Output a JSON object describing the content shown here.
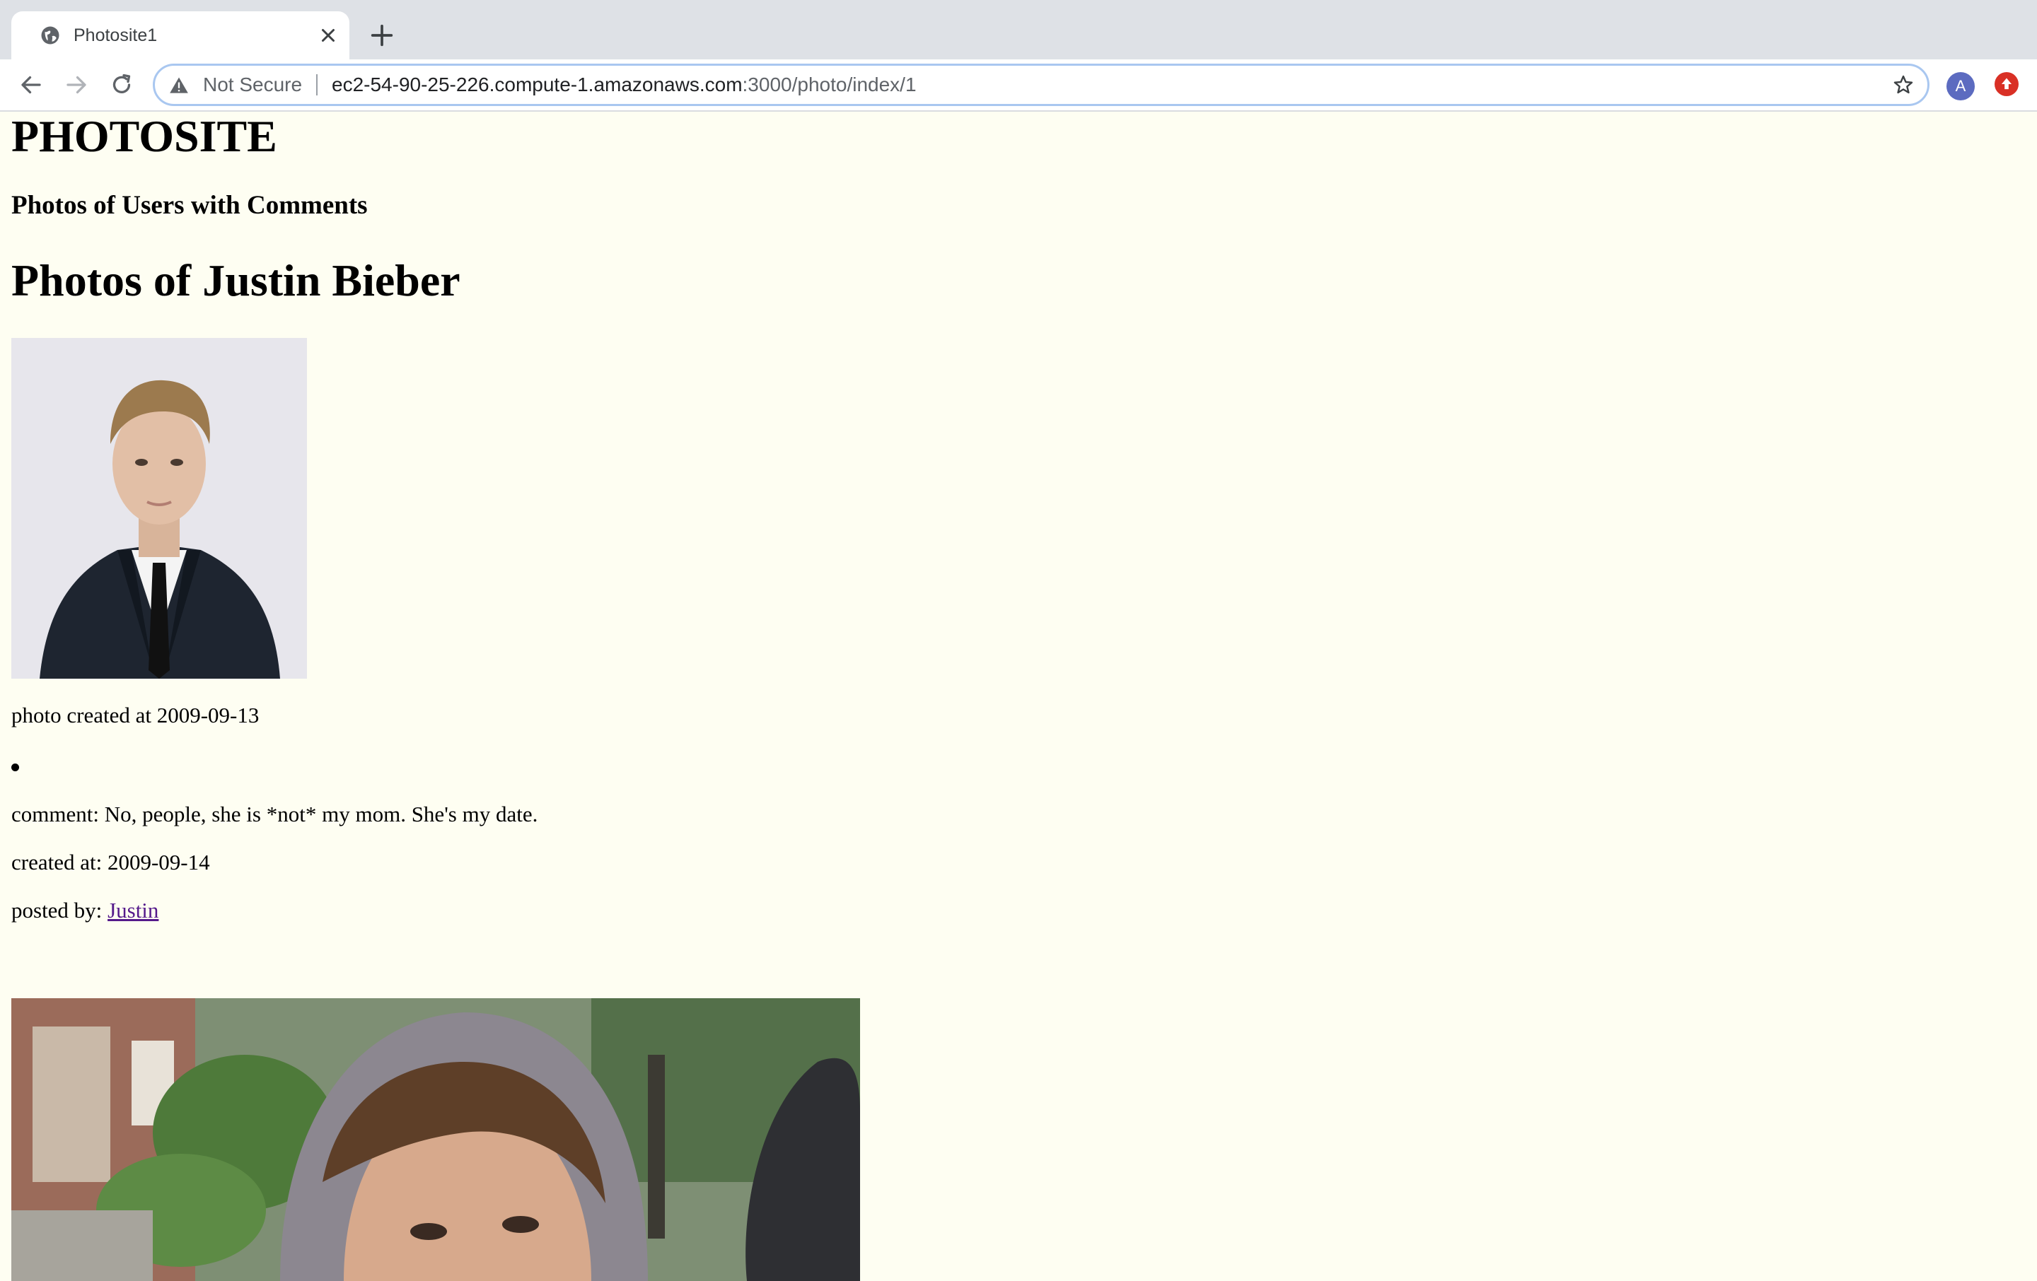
{
  "browser": {
    "tab_title": "Photosite1",
    "security_label": "Not Secure",
    "url_host": "ec2-54-90-25-226.compute-1.amazonaws.com",
    "url_path": ":3000/photo/index/1",
    "profile_initial": "A"
  },
  "page": {
    "site_title": "PHOTOSITE",
    "subtitle": "Photos of Users with Comments",
    "heading": "Photos of Justin Bieber",
    "photos": [
      {
        "created": "photo created at 2009-09-13",
        "comments": [
          {
            "comment": "comment: No, people, she is *not* my mom. She's my date.",
            "created": "created at: 2009-09-14",
            "posted_by_label": "posted by: ",
            "posted_by_user": "Justin"
          }
        ]
      }
    ]
  }
}
